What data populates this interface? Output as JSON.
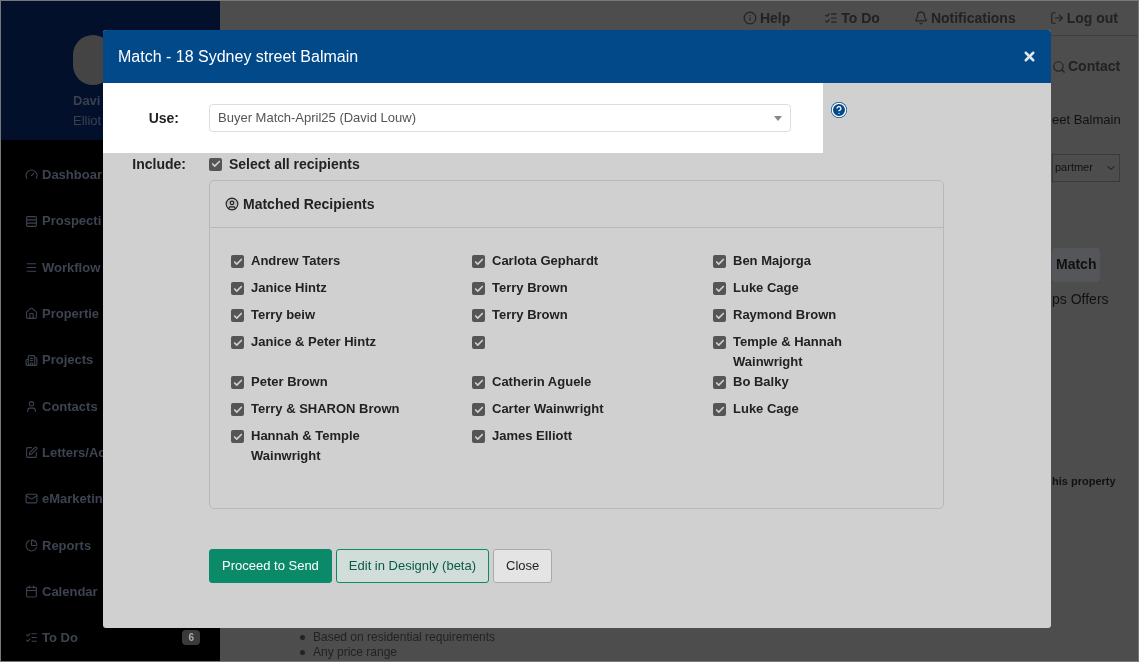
{
  "header_links": [
    {
      "label": "Help"
    },
    {
      "label": "To Do"
    },
    {
      "label": "Notifications"
    },
    {
      "label": "Log out"
    }
  ],
  "sidebar": {
    "user": {
      "name": "Davi",
      "subtitle": "Elliot"
    },
    "items": [
      {
        "label": "Dashboar"
      },
      {
        "label": "Prospecti"
      },
      {
        "label": "Workflow"
      },
      {
        "label": "Propertie"
      },
      {
        "label": "Projects"
      },
      {
        "label": "Contacts"
      },
      {
        "label": "Letters/Ac"
      },
      {
        "label": "eMarketin"
      },
      {
        "label": "Reports"
      },
      {
        "label": "Calendar"
      },
      {
        "label": "To Do",
        "badge": "6"
      }
    ]
  },
  "background": {
    "contact_search": "Contact",
    "property_title": "eet Balmain",
    "type_select": "partmer",
    "match_tab": "Match",
    "offers_tab": "ps Offers",
    "note": "his property",
    "bullets": [
      "Based on residential requirements",
      "Any price range"
    ]
  },
  "modal": {
    "title": "Match - 18 Sydney street Balmain",
    "use": {
      "label": "Use:",
      "value": "Buyer Match-April25 (David Louw)"
    },
    "include": {
      "label": "Include:",
      "select_all": {
        "label": "Select all recipients",
        "checked": true
      }
    },
    "recipients_panel": {
      "title": "Matched Recipients",
      "recipients": [
        {
          "name": "Andrew Taters",
          "checked": true
        },
        {
          "name": "Carlota Gephardt",
          "checked": true
        },
        {
          "name": "Ben Majorga",
          "checked": true
        },
        {
          "name": "Janice Hintz",
          "checked": true
        },
        {
          "name": "Terry Brown",
          "checked": true
        },
        {
          "name": "Luke Cage",
          "checked": true
        },
        {
          "name": "Terry beiw",
          "checked": true
        },
        {
          "name": "Terry Brown",
          "checked": true
        },
        {
          "name": "Raymond Brown",
          "checked": true
        },
        {
          "name": "Janice & Peter Hintz",
          "checked": true
        },
        {
          "checked": true
        },
        {
          "name": "Temple & Hannah Wainwright",
          "checked": true
        },
        {
          "name": "Peter Brown",
          "checked": true
        },
        {
          "name": "Catherin Aguele",
          "checked": true
        },
        {
          "name": "Bo Balky",
          "checked": true
        },
        {
          "name": "Terry & SHARON Brown",
          "checked": true
        },
        {
          "name": "Carter Wainwright",
          "checked": true
        },
        {
          "name": "Luke Cage",
          "checked": true
        },
        {
          "name": "Hannah & Temple Wainwright",
          "checked": true
        },
        {
          "name": "James Elliott",
          "checked": true
        }
      ]
    },
    "buttons": [
      {
        "label": "Proceed to Send",
        "kind": "primary"
      },
      {
        "label": "Edit in Designly (beta)",
        "kind": "outline"
      },
      {
        "label": "Close",
        "kind": "default"
      }
    ]
  }
}
